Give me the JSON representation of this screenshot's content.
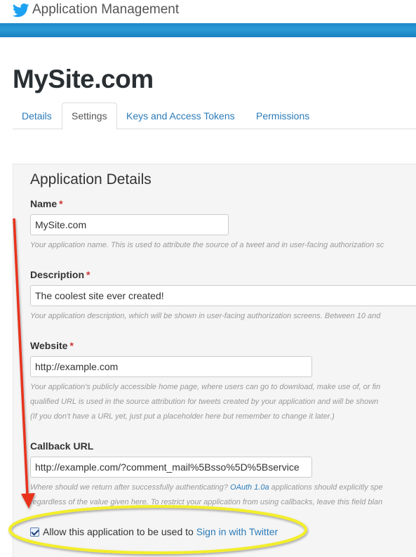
{
  "header": {
    "app_title": "Application Management",
    "logo_icon": "twitter-bird-icon",
    "brand_color": "#1da1f2",
    "band_color": "#2a9bd8"
  },
  "site_title": "MySite.com",
  "tabs": [
    {
      "label": "Details",
      "active": false
    },
    {
      "label": "Settings",
      "active": true
    },
    {
      "label": "Keys and Access Tokens",
      "active": false
    },
    {
      "label": "Permissions",
      "active": false
    }
  ],
  "panel": {
    "title": "Application Details",
    "fields": {
      "name": {
        "label": "Name",
        "required_mark": "*",
        "value": "MySite.com",
        "help": "Your application name. This is used to attribute the source of a tweet and in user-facing authorization sc"
      },
      "description": {
        "label": "Description",
        "required_mark": "*",
        "value": "The coolest site ever created!",
        "help": "Your application description, which will be shown in user-facing authorization screens. Between 10 and"
      },
      "website": {
        "label": "Website",
        "required_mark": "*",
        "value": "http://example.com",
        "help_lines": [
          "Your application's publicly accessible home page, where users can go to download, make use of, or fin",
          "qualified URL is used in the source attribution for tweets created by your application and will be shown",
          "(If you don't have a URL yet, just put a placeholder here but remember to change it later.)"
        ]
      },
      "callback": {
        "label": "Callback URL",
        "value": "http://example.com/?comment_mail%5Bsso%5D%5Bservice",
        "help_line1_prefix": "Where should we return after successfully authenticating? ",
        "help_line1_link": "OAuth 1.0a",
        "help_line1_suffix": " applications should explicitly spe",
        "help_line2": "regardless of the value given here. To restrict your application from using callbacks, leave this field blan"
      }
    },
    "signin_checkbox": {
      "checked": true,
      "label_prefix": "Allow this application to be used to ",
      "label_link": "Sign in with Twitter"
    }
  },
  "annotations": {
    "arrow_color": "#e8301c",
    "highlight_color": "#f3ee2a"
  }
}
